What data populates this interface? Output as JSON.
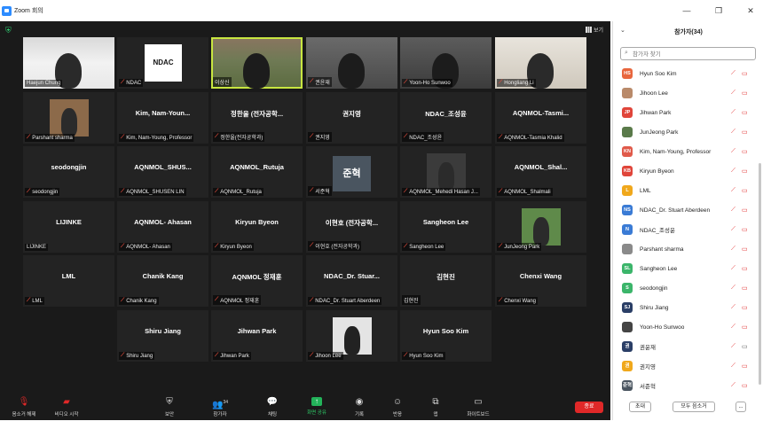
{
  "window": {
    "title": "Zoom 회의"
  },
  "meeting": {
    "view_label": "보기"
  },
  "tiles": [
    {
      "big": "",
      "label": "Haejun Chung",
      "mic_muted": false
    },
    {
      "big": "",
      "label": "NDAC",
      "mic_muted": true,
      "logo": "NDAC"
    },
    {
      "big": "",
      "label": "이상신",
      "mic_muted": false
    },
    {
      "big": "",
      "label": "권윤재",
      "mic_muted": true
    },
    {
      "big": "",
      "label": "Yoon-Ho Sunwoo",
      "mic_muted": true
    },
    {
      "big": "",
      "label": "Hongliang Li",
      "mic_muted": true
    },
    {
      "big": "",
      "label": "Parshant sharma",
      "mic_muted": true
    },
    {
      "big": "Kim,  Nam-Youn...",
      "label": "Kim, Nam-Young, Professor",
      "mic_muted": true
    },
    {
      "big": "정한울 (전자공학...",
      "label": "정한울(전자공학과)",
      "mic_muted": true
    },
    {
      "big": "권지영",
      "label": "권지영",
      "mic_muted": true
    },
    {
      "big": "NDAC_조성윤",
      "label": "NDAC_조성윤",
      "mic_muted": true
    },
    {
      "big": "AQNMOL-Tasmi...",
      "label": "AQNMOL-Tasmia Khalid",
      "mic_muted": true
    },
    {
      "big": "seodongjin",
      "label": "seodongjin",
      "mic_muted": true
    },
    {
      "big": "AQNMOL_SHUS...",
      "label": "AQNMOL_SHUSEN LIN",
      "mic_muted": true
    },
    {
      "big": "AQNMOL_Rutuja",
      "label": "AQNMOL_Rutuja",
      "mic_muted": true
    },
    {
      "big": "",
      "label": "서준혁",
      "mic_muted": true,
      "tag": "준혁"
    },
    {
      "big": "",
      "label": "AQNMOL_Mehedi Hasan J...",
      "mic_muted": true
    },
    {
      "big": "AQNMOL_Shal...",
      "label": "AQNMOL_Shalmali",
      "mic_muted": true
    },
    {
      "big": "LIJINKE",
      "label": "LIJINKE",
      "mic_muted": false
    },
    {
      "big": "AQNMOL- Ahasan",
      "label": "AQNMOL- Ahasan",
      "mic_muted": true
    },
    {
      "big": "Kiryun Byeon",
      "label": "Kiryun Byeon",
      "mic_muted": true
    },
    {
      "big": "이현호 (전자공학...",
      "label": "이현호 (전자공학과)",
      "mic_muted": true
    },
    {
      "big": "Sangheon Lee",
      "label": "Sangheon Lee",
      "mic_muted": true
    },
    {
      "big": "",
      "label": "JunJeong Park",
      "mic_muted": true
    },
    {
      "big": "LML",
      "label": "LML",
      "mic_muted": true
    },
    {
      "big": "Chanik Kang",
      "label": "Chanik Kang",
      "mic_muted": true
    },
    {
      "big": "AQNMOL 정재훈",
      "label": "AQNMOL 정재훈",
      "mic_muted": true
    },
    {
      "big": "NDAC_Dr. Stuar...",
      "label": "NDAC_Dr. Stuart Aberdeen",
      "mic_muted": true
    },
    {
      "big": "김현진",
      "label": "김현진",
      "mic_muted": false
    },
    {
      "big": "Chenxi Wang",
      "label": "Chenxi Wang",
      "mic_muted": true
    },
    {
      "big": "Shiru Jiang",
      "label": "Shiru Jiang",
      "mic_muted": true
    },
    {
      "big": "Jihwan Park",
      "label": "Jihwan Park",
      "mic_muted": true
    },
    {
      "big": "",
      "label": "Jihoon Lee",
      "mic_muted": true
    },
    {
      "big": "Hyun Soo Kim",
      "label": "Hyun Soo Kim",
      "mic_muted": true
    }
  ],
  "toolbar": {
    "mute": "음소거 해제",
    "video": "비디오 시작",
    "security": "보안",
    "participants": "참가자",
    "participants_count": "34",
    "chat": "채팅",
    "share": "화면 공유",
    "record": "기록",
    "reactions": "반응",
    "apps": "앱",
    "whiteboard": "화이트보드",
    "end": "종료"
  },
  "panel": {
    "title": "참가자(34)",
    "search_placeholder": "참가자 찾기",
    "invite": "초대",
    "mute_all": "모두 음소거",
    "more": "...",
    "participants": [
      {
        "initials": "HS",
        "color": "#e8663d",
        "name": "Hyun Soo Kim",
        "cam_on": false
      },
      {
        "initials": "",
        "color": "#b98a6a",
        "name": "Jihoon Lee",
        "cam_on": false
      },
      {
        "initials": "JP",
        "color": "#e0453a",
        "name": "Jihwan Park",
        "cam_on": false
      },
      {
        "initials": "",
        "color": "#5a7a4a",
        "name": "JunJeong Park",
        "cam_on": false
      },
      {
        "initials": "KN",
        "color": "#e05a4a",
        "name": "Kim, Nam-Young, Professor",
        "cam_on": false
      },
      {
        "initials": "KB",
        "color": "#e0453a",
        "name": "Kiryun Byeon",
        "cam_on": false
      },
      {
        "initials": "L",
        "color": "#f0a81c",
        "name": "LML",
        "cam_on": false
      },
      {
        "initials": "NS",
        "color": "#3a7bd5",
        "name": "NDAC_Dr. Stuart Aberdeen",
        "cam_on": false
      },
      {
        "initials": "N",
        "color": "#3a7bd5",
        "name": "NDAC_조성윤",
        "cam_on": false
      },
      {
        "initials": "",
        "color": "#8a8a8a",
        "name": "Parshant sharma",
        "cam_on": false
      },
      {
        "initials": "SL",
        "color": "#3bb56a",
        "name": "Sangheon Lee",
        "cam_on": false
      },
      {
        "initials": "S",
        "color": "#3bb56a",
        "name": "seodongjin",
        "cam_on": false
      },
      {
        "initials": "SJ",
        "color": "#2a3e66",
        "name": "Shiru Jiang",
        "cam_on": false
      },
      {
        "initials": "",
        "color": "#444444",
        "name": "Yoon-Ho Sunwoo",
        "cam_on": false
      },
      {
        "initials": "권",
        "color": "#2a3e66",
        "name": "권윤재",
        "cam_on": true
      },
      {
        "initials": "권",
        "color": "#f0a81c",
        "name": "권지영",
        "cam_on": false
      },
      {
        "initials": "준혁",
        "color": "#4a5560",
        "name": "서준혁",
        "cam_on": false
      }
    ]
  }
}
